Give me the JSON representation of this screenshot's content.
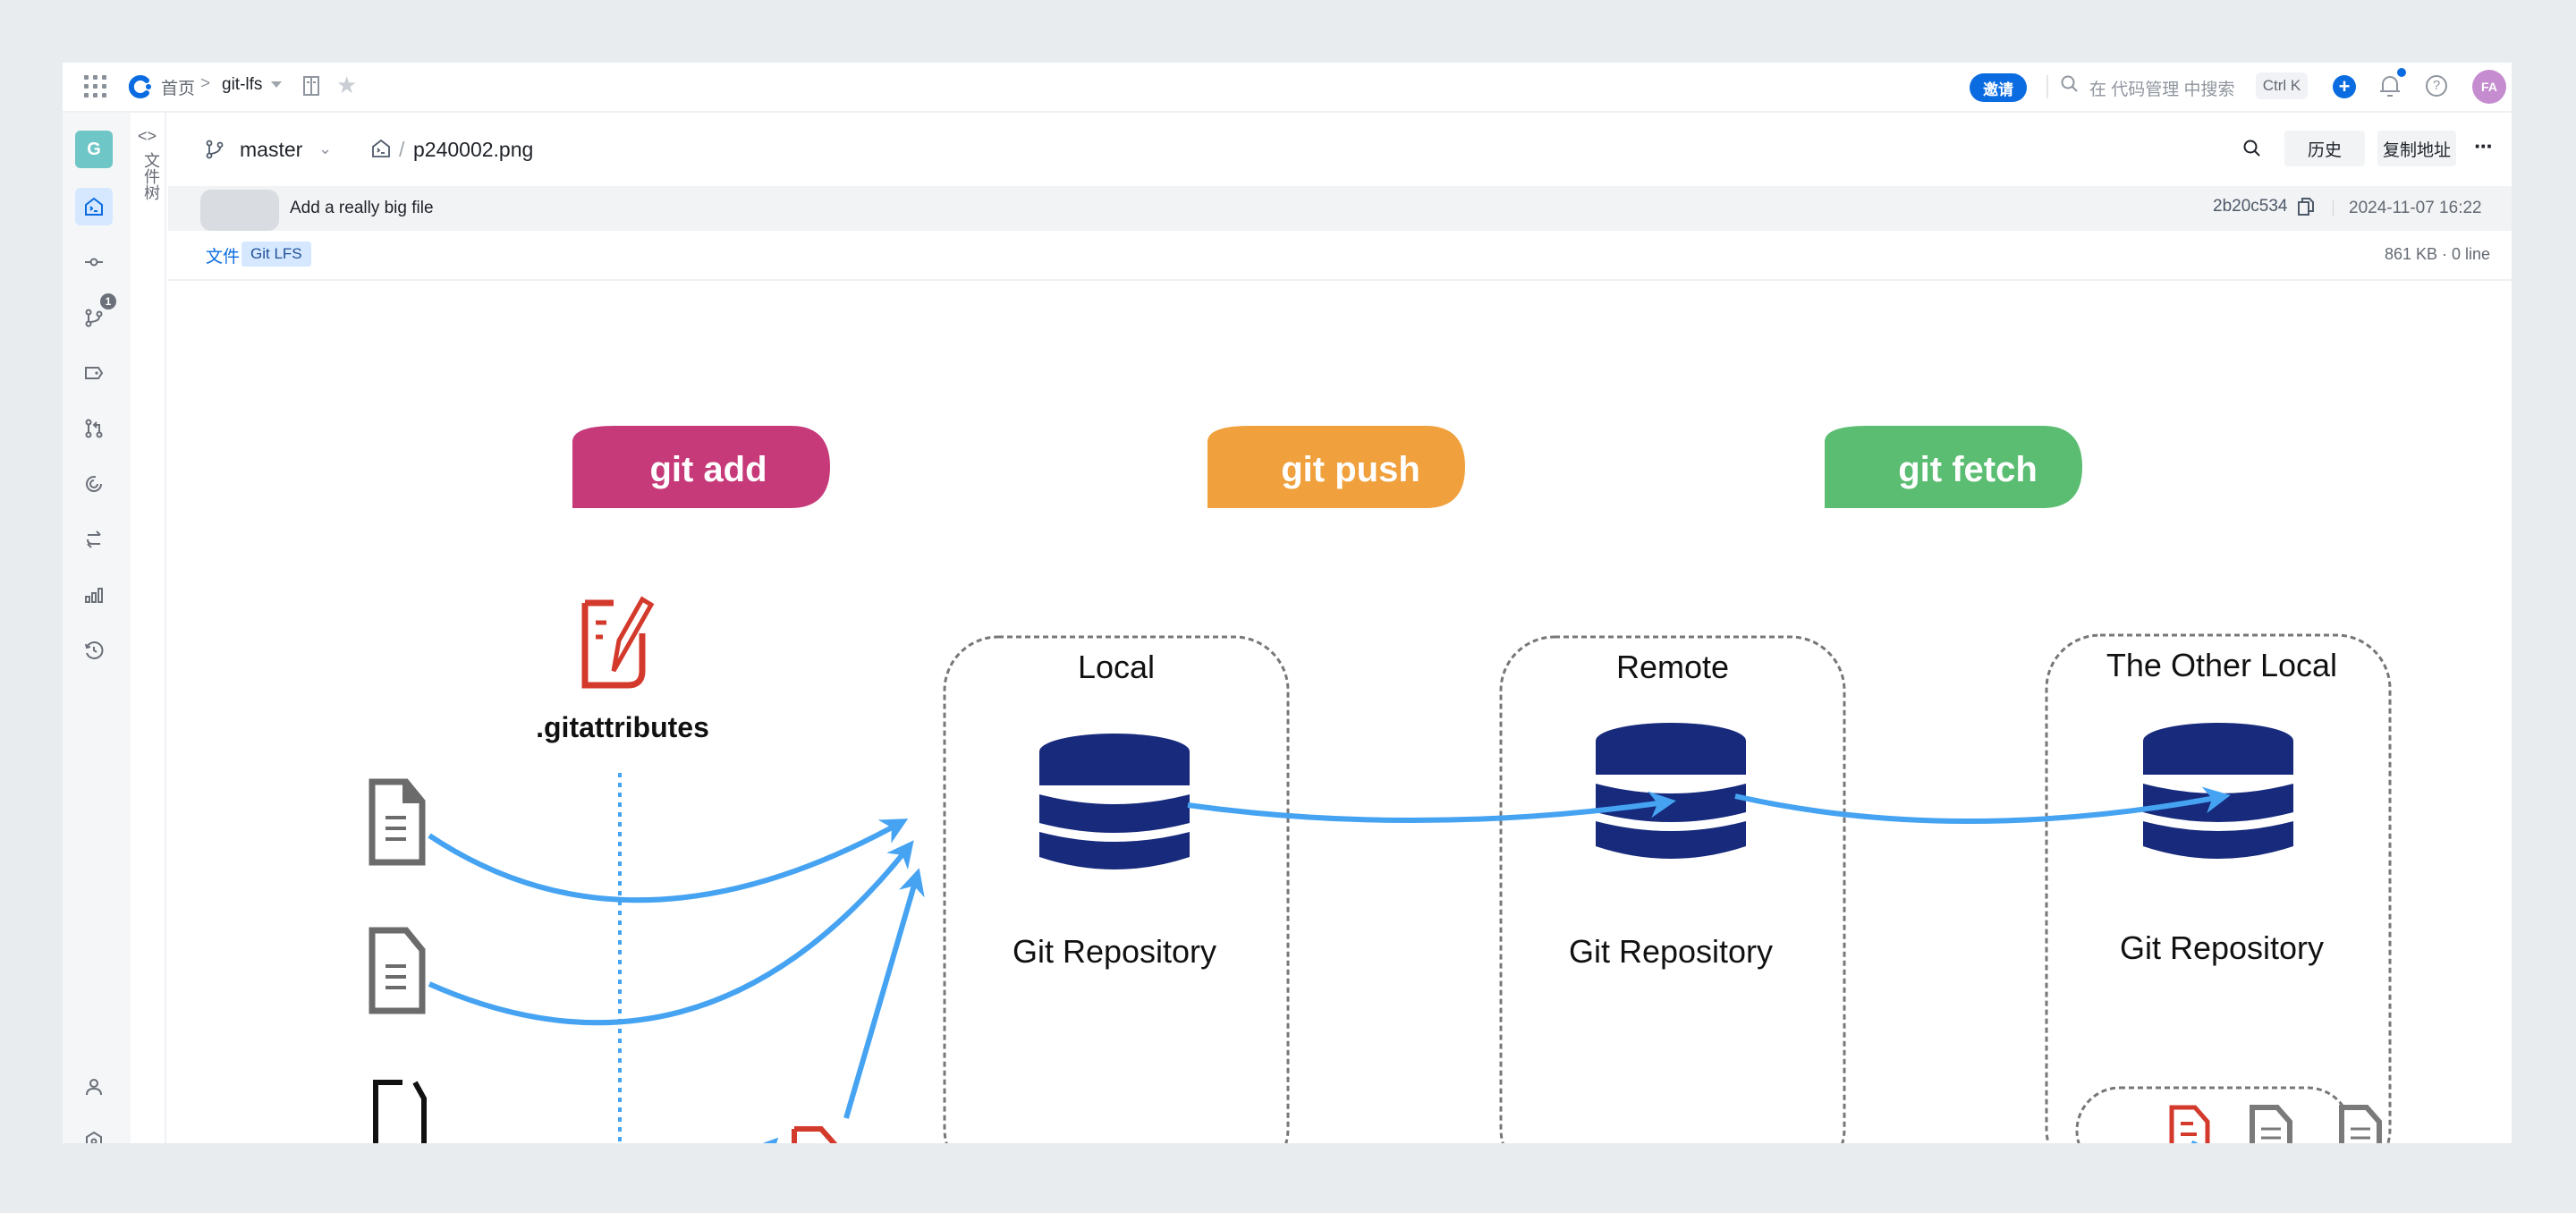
{
  "topbar": {
    "breadcrumb_home": "首页",
    "breadcrumb_sep": ">",
    "repo_name": "git-lfs",
    "invite_label": "邀请",
    "search_placeholder": "在 代码管理 中搜索",
    "search_shortcut": "Ctrl K",
    "plus_label": "+",
    "help_label": "?",
    "avatar_initials": "FA",
    "accent_color": "#0a6ce0"
  },
  "rail": {
    "project_initial": "G",
    "items": [
      {
        "icon": "code-repo-icon",
        "active": true
      },
      {
        "icon": "commit-icon",
        "active": false
      },
      {
        "icon": "branch-icon",
        "active": false,
        "badge": "1"
      },
      {
        "icon": "tag-icon",
        "active": false
      },
      {
        "icon": "merge-request-icon",
        "active": false
      },
      {
        "icon": "pipeline-icon",
        "active": false
      },
      {
        "icon": "compare-icon",
        "active": false
      },
      {
        "icon": "stats-icon",
        "active": false
      },
      {
        "icon": "history-icon",
        "active": false
      }
    ],
    "bottom_items": [
      {
        "icon": "members-icon"
      },
      {
        "icon": "settings-icon"
      }
    ]
  },
  "tree": {
    "toggle_label": "<>",
    "label": "文件树"
  },
  "pathbar": {
    "branch": "master",
    "path_sep": "/",
    "file_name": "p240002.png",
    "history_label": "历史",
    "copy_address_label": "复制地址",
    "more_label": "···"
  },
  "commit": {
    "message": "Add a really big file",
    "hash": "2b20c534",
    "time": "2024-11-07 16:22"
  },
  "filetabs": {
    "file_tab": "文件",
    "lfs_tag": "Git LFS",
    "size_info": "861 KB · 0 line"
  },
  "diagram": {
    "pills": [
      {
        "label": "git add",
        "color": "#c63a7a"
      },
      {
        "label": "git push",
        "color": "#f0a03c"
      },
      {
        "label": "git fetch",
        "color": "#5bbd72"
      }
    ],
    "attributes_label": ".gitattributes",
    "boxes": [
      {
        "title": "Local",
        "repo_label": "Git Repository"
      },
      {
        "title": "Remote",
        "repo_label": "Git Repository"
      },
      {
        "title": "The Other Local",
        "repo_label": "Git Repository"
      }
    ],
    "arrow_color": "#45a3f2",
    "db_color": "#172a7c",
    "pointer_color": "#d33a2c"
  }
}
